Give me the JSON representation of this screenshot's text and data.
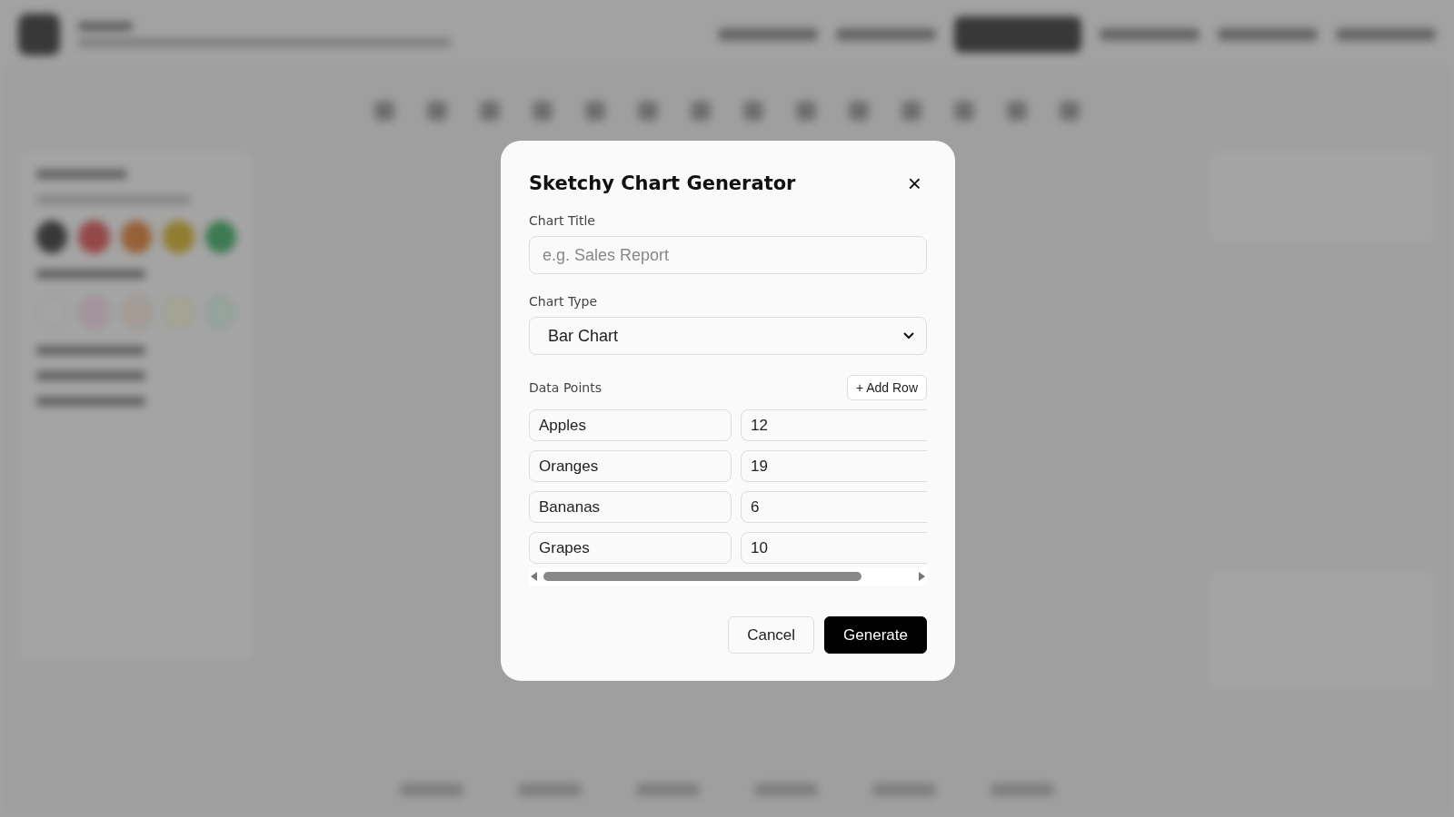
{
  "dialog": {
    "title": "Sketchy Chart Generator",
    "close": "×",
    "chart_title": {
      "label": "Chart Title",
      "placeholder": "e.g. Sales Report"
    },
    "chart_type": {
      "label": "Chart Type",
      "value": "Bar Chart"
    },
    "data_points": {
      "label": "Data Points",
      "add_button": "+ Add Row",
      "rows": [
        {
          "label": "Apples",
          "value": "12"
        },
        {
          "label": "Oranges",
          "value": "19"
        },
        {
          "label": "Bananas",
          "value": "6"
        },
        {
          "label": "Grapes",
          "value": "10"
        }
      ]
    },
    "buttons": [
      {
        "label": "Cancel",
        "kind": "secondary"
      },
      {
        "label": "Generate",
        "kind": "primary"
      }
    ]
  }
}
